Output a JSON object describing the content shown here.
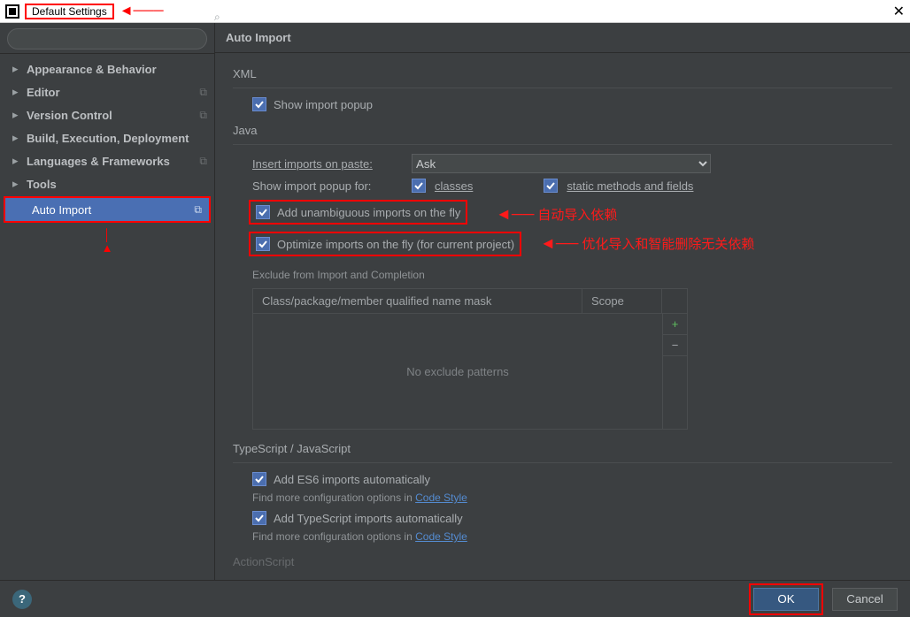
{
  "titlebar": {
    "title": "Default Settings"
  },
  "sidebar": {
    "search_placeholder": "",
    "items": [
      {
        "label": "Appearance & Behavior"
      },
      {
        "label": "Editor"
      },
      {
        "label": "Version Control"
      },
      {
        "label": "Build, Execution, Deployment"
      },
      {
        "label": "Languages & Frameworks"
      },
      {
        "label": "Tools"
      }
    ],
    "selected": {
      "label": "Auto Import"
    }
  },
  "main": {
    "title": "Auto Import",
    "xml": {
      "title": "XML",
      "show_popup": "Show import popup"
    },
    "java": {
      "title": "Java",
      "insert_label": "Insert imports on paste:",
      "insert_value": "Ask",
      "show_popup_label": "Show import popup for:",
      "classes": "classes",
      "static": "static methods and fields",
      "unambiguous": "Add unambiguous imports on the fly",
      "optimize": "Optimize imports on the fly (for current project)",
      "exclude_title": "Exclude from Import and Completion",
      "col_mask": "Class/package/member qualified name mask",
      "col_scope": "Scope",
      "empty": "No exclude patterns"
    },
    "ts": {
      "title": "TypeScript / JavaScript",
      "es6": "Add ES6 imports automatically",
      "tsimp": "Add TypeScript imports automatically",
      "find_more": "Find more configuration options in ",
      "link": "Code Style"
    },
    "as": {
      "title": "ActionScript"
    }
  },
  "footer": {
    "ok": "OK",
    "cancel": "Cancel"
  },
  "annot": {
    "a1": "自动导入依赖",
    "a2": "优化导入和智能删除无关依赖"
  }
}
